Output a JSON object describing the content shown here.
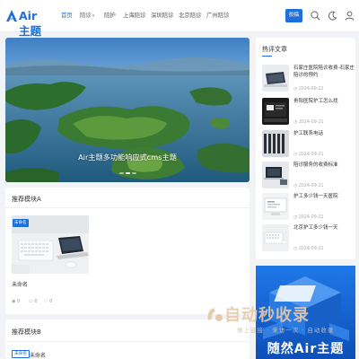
{
  "header": {
    "logo_text": "Air主题",
    "nav": [
      {
        "label": "首页",
        "has_caret": false,
        "active": true
      },
      {
        "label": "陪诊",
        "has_caret": true,
        "active": false
      },
      {
        "label": "陪护",
        "has_caret": false,
        "active": false
      },
      {
        "label": "上海陪诊",
        "has_caret": false,
        "active": false
      },
      {
        "label": "深圳陪诊",
        "has_caret": false,
        "active": false
      },
      {
        "label": "北京陪诊",
        "has_caret": false,
        "active": false
      },
      {
        "label": "广州陪诊",
        "has_caret": false,
        "active": false
      }
    ],
    "post_button": "投稿",
    "icons": [
      "search-icon",
      "moon-icon",
      "user-icon"
    ],
    "accent": "#1e6fd9"
  },
  "banner": {
    "caption": "Air主题多功能响应式cms主题",
    "dot_count": 3,
    "active_dot": 1
  },
  "module_a": {
    "title": "推荐模块A",
    "post": {
      "tag": "未命名",
      "title": "未命名",
      "views": "0",
      "comments": "0",
      "likes": "0"
    }
  },
  "module_b": {
    "title": "推荐模块B",
    "tag": "未命名",
    "title_text": "未命名"
  },
  "sidebar": {
    "title": "热评文章",
    "items": [
      {
        "title": "石家庄医院陪诊收费-石家庄陪诊的预约",
        "date": "2024-09-22"
      },
      {
        "title": "贵阳医院护工怎么找",
        "date": "2024-09-21"
      },
      {
        "title": "护工联系电话",
        "date": "2024-09-21"
      },
      {
        "title": "陪诊服务的收费标准",
        "date": "2024-09-21"
      },
      {
        "title": "护工多少钱一天医院",
        "date": "2024-09-21"
      },
      {
        "title": "北京护工多少钱一天",
        "date": "2024-09-21"
      }
    ]
  },
  "ad": {
    "brand": "随然Air主题"
  },
  "watermark": {
    "text": "自动秒收录",
    "sub": "做上链接 · 来访一次 · 自动收录"
  }
}
